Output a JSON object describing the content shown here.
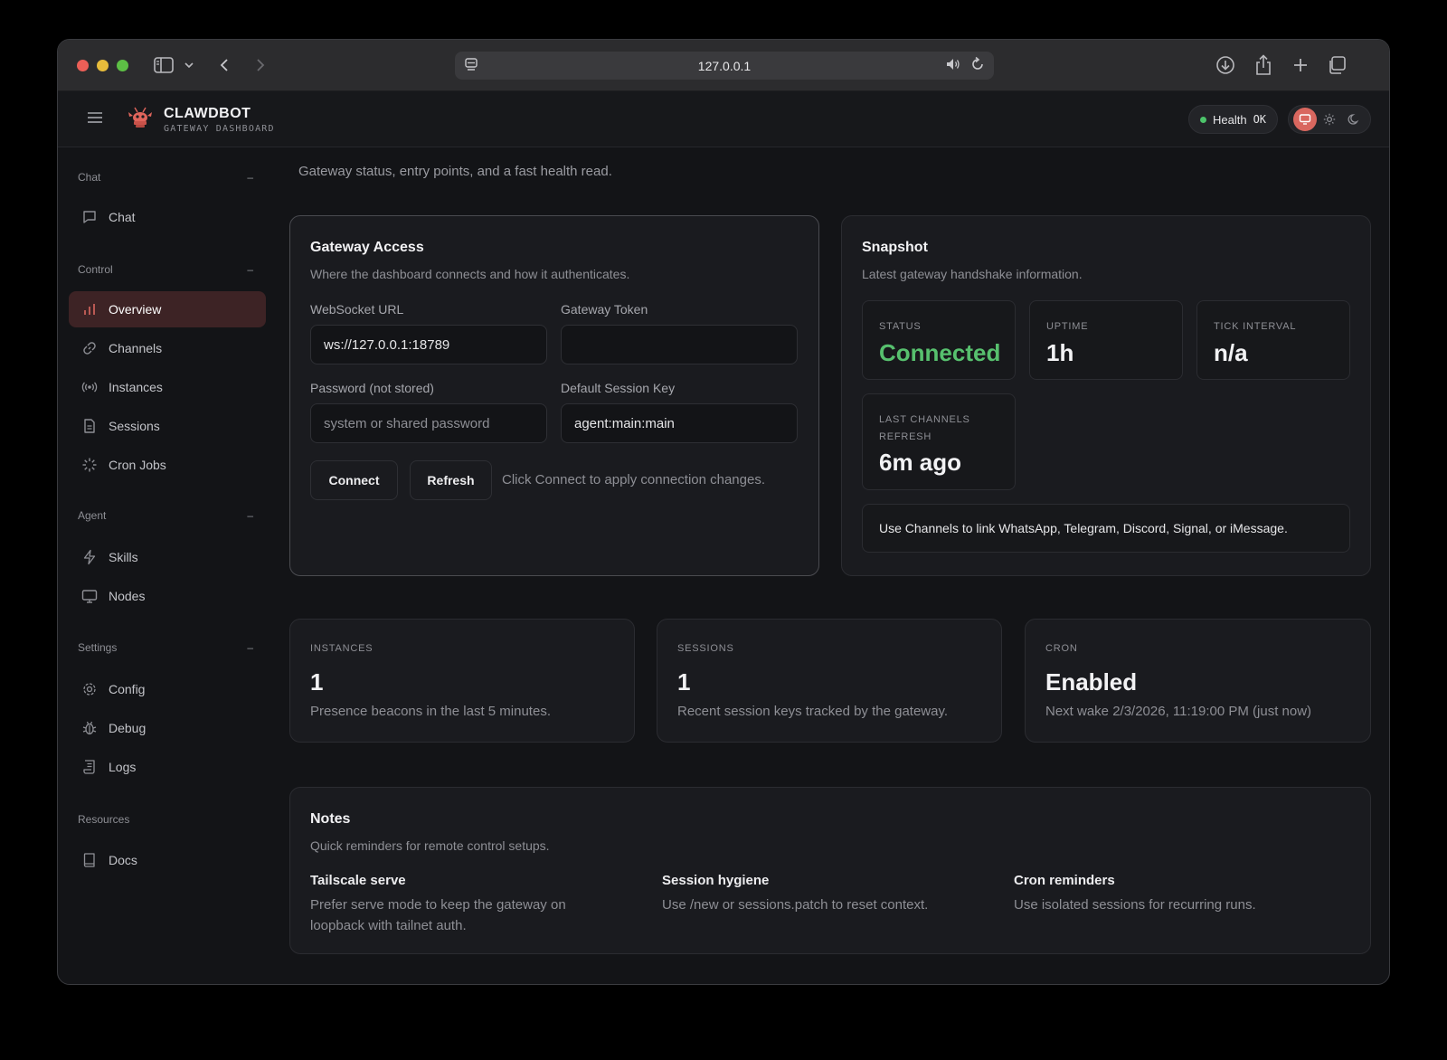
{
  "browser": {
    "url": "127.0.0.1"
  },
  "header": {
    "brand_name": "CLAWDBOT",
    "brand_sub": "GATEWAY DASHBOARD",
    "health_label": "Health",
    "health_status": "OK"
  },
  "sidebar": {
    "groups": {
      "chat": "Chat",
      "control": "Control",
      "agent": "Agent",
      "settings": "Settings",
      "resources": "Resources"
    },
    "collapse_symbol": "–",
    "items": {
      "chat": "Chat",
      "overview": "Overview",
      "channels": "Channels",
      "instances": "Instances",
      "sessions": "Sessions",
      "cron_jobs": "Cron Jobs",
      "skills": "Skills",
      "nodes": "Nodes",
      "config": "Config",
      "debug": "Debug",
      "logs": "Logs",
      "docs": "Docs"
    }
  },
  "main": {
    "subtitle": "Gateway status, entry points, and a fast health read."
  },
  "gateway_access": {
    "title": "Gateway Access",
    "subtitle": "Where the dashboard connects and how it authenticates.",
    "ws_label": "WebSocket URL",
    "ws_value": "ws://127.0.0.1:18789",
    "token_label": "Gateway Token",
    "token_value": "",
    "password_label": "Password (not stored)",
    "password_placeholder": "system or shared password",
    "session_key_label": "Default Session Key",
    "session_key_value": "agent:main:main",
    "connect_label": "Connect",
    "refresh_label": "Refresh",
    "hint": "Click Connect to apply connection changes."
  },
  "snapshot": {
    "title": "Snapshot",
    "subtitle": "Latest gateway handshake information.",
    "status_label": "STATUS",
    "status_value": "Connected",
    "uptime_label": "UPTIME",
    "uptime_value": "1h",
    "tick_label": "TICK INTERVAL",
    "tick_value": "n/a",
    "last_refresh_label": "LAST CHANNELS REFRESH",
    "last_refresh_value": "6m ago",
    "info": "Use Channels to link WhatsApp, Telegram, Discord, Signal, or iMessage."
  },
  "metrics": {
    "instances": {
      "label": "INSTANCES",
      "value": "1",
      "desc": "Presence beacons in the last 5 minutes."
    },
    "sessions": {
      "label": "SESSIONS",
      "value": "1",
      "desc": "Recent session keys tracked by the gateway."
    },
    "cron": {
      "label": "CRON",
      "value": "Enabled",
      "desc": "Next wake 2/3/2026, 11:19:00 PM (just now)"
    }
  },
  "notes": {
    "title": "Notes",
    "subtitle": "Quick reminders for remote control setups.",
    "items": [
      {
        "title": "Tailscale serve",
        "text": "Prefer serve mode to keep the gateway on loopback with tailnet auth."
      },
      {
        "title": "Session hygiene",
        "text": "Use /new or sessions.patch to reset context."
      },
      {
        "title": "Cron reminders",
        "text": "Use isolated sessions for recurring runs."
      }
    ]
  },
  "colors": {
    "accent": "#d9675f",
    "success": "#57c06e",
    "background": "#131417",
    "card": "#1a1b1f",
    "active_nav": "#3d2325"
  },
  "icons": {
    "header": [
      "menu-icon",
      "lobster-logo-icon",
      "monitor-icon",
      "sun-icon",
      "moon-icon"
    ],
    "sidebar": [
      "chat-bubble-icon",
      "bar-chart-icon",
      "link-icon",
      "radio-icon",
      "file-icon",
      "loader-icon",
      "bolt-icon",
      "monitor-icon",
      "gear-icon",
      "bug-icon",
      "scroll-icon",
      "book-icon"
    ]
  }
}
